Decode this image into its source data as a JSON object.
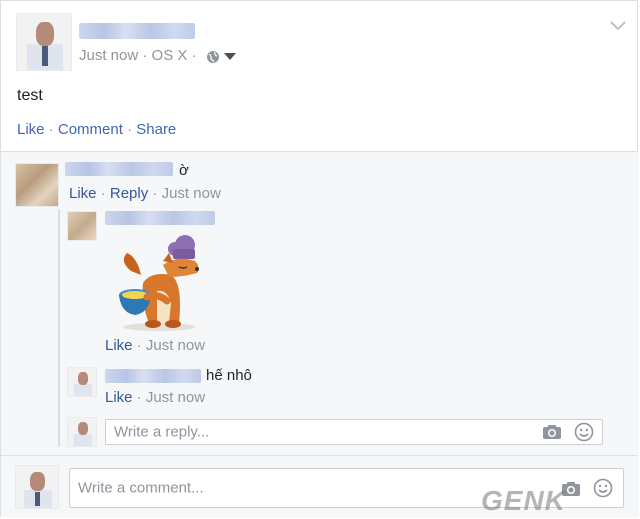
{
  "post": {
    "meta": {
      "time": "Just now",
      "separator": "·",
      "platform": "OS X"
    },
    "body": "test",
    "actions": {
      "like": "Like",
      "comment": "Comment",
      "share": "Share",
      "separator": "·"
    }
  },
  "comments": [
    {
      "text": "ờ",
      "actions": {
        "like": "Like",
        "reply": "Reply",
        "time": "Just now",
        "separator": "·"
      },
      "replies": [
        {
          "sticker": "chef-fox-sticker",
          "actions": {
            "like": "Like",
            "time": "Just now",
            "separator": "·"
          }
        },
        {
          "text": "hế nhô",
          "actions": {
            "like": "Like",
            "time": "Just now",
            "separator": "·"
          }
        }
      ]
    }
  ],
  "reply_input": {
    "placeholder": "Write a reply..."
  },
  "comment_input": {
    "placeholder": "Write a comment..."
  },
  "watermark": {
    "text": "GENK"
  },
  "colors": {
    "link": "#4267b2",
    "meta": "#90949c",
    "text": "#1d2129",
    "border": "#dddfe2"
  },
  "icons": [
    "globe-icon",
    "caret-down-icon",
    "chevron-down-icon",
    "camera-icon",
    "smiley-icon"
  ]
}
